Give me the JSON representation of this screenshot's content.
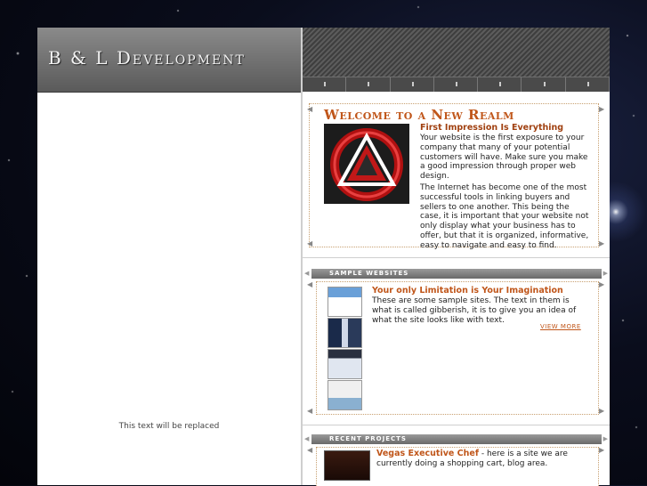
{
  "header": {
    "logo_text": "B & L Development"
  },
  "left_column": {
    "placeholder_text": "This text will be replaced"
  },
  "welcome": {
    "title": "Welcome to a New Realm",
    "subheading": "First Impression Is Everything",
    "paragraph_1": "Your website is the first exposure to your company that many of your potential customers will have. Make sure you make a good impression through proper web design.",
    "paragraph_2": "The Internet has become one of the most successful tools in linking buyers and sellers to one another. This being the case, it is important that your website not only display what your business has to offer, but that it is organized, informative, easy to navigate and easy to find."
  },
  "samples": {
    "section_label": "SAMPLE WEBSITES",
    "heading": "Your only Limitation is Your Imagination",
    "body": "These are some sample sites. The text in them is what is called gibberish, it is to give you an idea of what the site looks like with text.",
    "view_more_label": "VIEW MORE"
  },
  "projects": {
    "section_label": "RECENT PROJECTS",
    "item_title": "Vegas Executive Chef",
    "item_body": " - here is a site we are currently doing a shopping cart, blog area."
  },
  "colors": {
    "accent": "#c0561a",
    "header_gray": "#6a6a6a"
  }
}
